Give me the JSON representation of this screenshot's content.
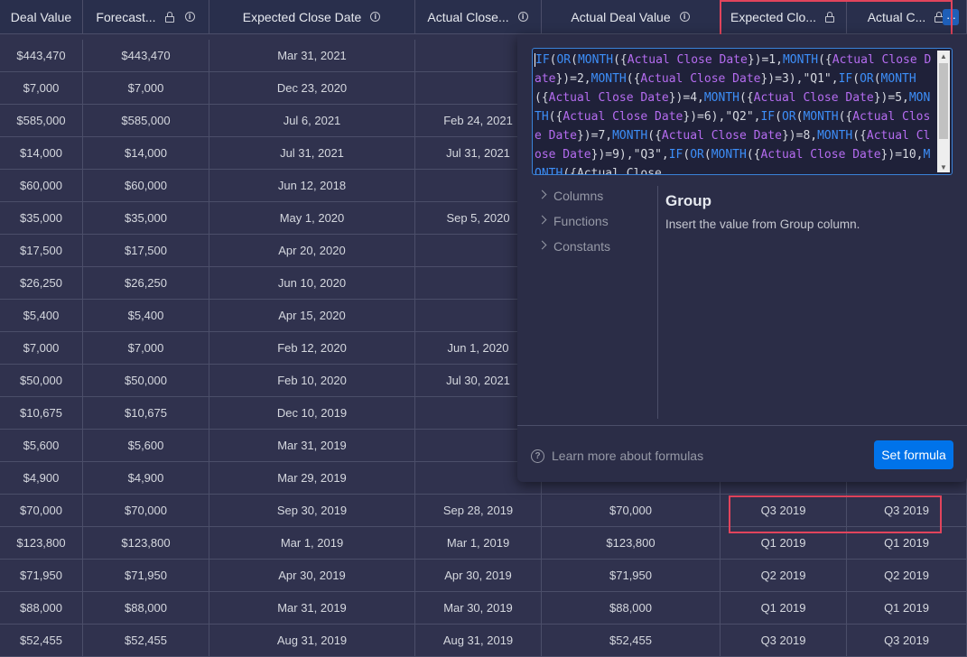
{
  "columns": [
    {
      "label": "Deal Value",
      "lock": false,
      "info": false
    },
    {
      "label": "Forecast...",
      "lock": true,
      "info": true
    },
    {
      "label": "Expected Close Date",
      "lock": false,
      "info": true
    },
    {
      "label": "Actual Close...",
      "lock": false,
      "info": true
    },
    {
      "label": "Actual Deal Value",
      "lock": false,
      "info": true
    },
    {
      "label": "Expected Clo...",
      "lock": true,
      "info": false
    },
    {
      "label": "Actual C...",
      "lock": true,
      "info": false
    }
  ],
  "rows": [
    [
      "$443,470",
      "$443,470",
      "Mar 31, 2021",
      "",
      "",
      "",
      ""
    ],
    [
      "$7,000",
      "$7,000",
      "Dec 23, 2020",
      "",
      "",
      "",
      ""
    ],
    [
      "$585,000",
      "$585,000",
      "Jul 6, 2021",
      "Feb 24, 2021",
      "",
      "",
      ""
    ],
    [
      "$14,000",
      "$14,000",
      "Jul 31, 2021",
      "Jul 31, 2021",
      "",
      "",
      ""
    ],
    [
      "$60,000",
      "$60,000",
      "Jun 12, 2018",
      "",
      "",
      "",
      ""
    ],
    [
      "$35,000",
      "$35,000",
      "May 1, 2020",
      "Sep 5, 2020",
      "",
      "",
      ""
    ],
    [
      "$17,500",
      "$17,500",
      "Apr 20, 2020",
      "",
      "",
      "",
      ""
    ],
    [
      "$26,250",
      "$26,250",
      "Jun 10, 2020",
      "",
      "",
      "",
      ""
    ],
    [
      "$5,400",
      "$5,400",
      "Apr 15, 2020",
      "",
      "",
      "",
      ""
    ],
    [
      "$7,000",
      "$7,000",
      "Feb 12, 2020",
      "Jun 1, 2020",
      "",
      "",
      ""
    ],
    [
      "$50,000",
      "$50,000",
      "Feb 10, 2020",
      "Jul 30, 2021",
      "",
      "",
      ""
    ],
    [
      "$10,675",
      "$10,675",
      "Dec 10, 2019",
      "",
      "",
      "",
      ""
    ],
    [
      "$5,600",
      "$5,600",
      "Mar 31, 2019",
      "",
      "",
      "",
      ""
    ],
    [
      "$4,900",
      "$4,900",
      "Mar 29, 2019",
      "",
      "",
      "",
      ""
    ],
    [
      "$70,000",
      "$70,000",
      "Sep 30, 2019",
      "Sep 28, 2019",
      "$70,000",
      "Q3 2019",
      "Q3 2019"
    ],
    [
      "$123,800",
      "$123,800",
      "Mar 1, 2019",
      "Mar 1, 2019",
      "$123,800",
      "Q1 2019",
      "Q1 2019"
    ],
    [
      "$71,950",
      "$71,950",
      "Apr 30, 2019",
      "Apr 30, 2019",
      "$71,950",
      "Q2 2019",
      "Q2 2019"
    ],
    [
      "$88,000",
      "$88,000",
      "Mar 31, 2019",
      "Mar 30, 2019",
      "$88,000",
      "Q1 2019",
      "Q1 2019"
    ],
    [
      "$52,455",
      "$52,455",
      "Aug 31, 2019",
      "Aug 31, 2019",
      "$52,455",
      "Q3 2019",
      "Q3 2019"
    ]
  ],
  "formula_popup": {
    "formula_text": "IF(OR(MONTH({Actual Close Date})=1,MONTH({Actual Close Date})=2,MONTH({Actual Close Date})=3),\"Q1\",IF(OR(MONTH({Actual Close Date})=4,MONTH({Actual Close Date})=5,MONTH({Actual Close Date})=6),\"Q2\",IF(OR(MONTH({Actual Close Date})=7,MONTH({Actual Close Date})=8,MONTH({Actual Close Date})=9),\"Q3\",IF(OR(MONTH({Actual Close Date})=10,MONTH({Actual Close",
    "nav": [
      "Columns",
      "Functions",
      "Constants"
    ],
    "detail_title": "Group",
    "detail_desc": "Insert the value from Group column.",
    "help_text": "Learn more about formulas",
    "set_button": "Set formula"
  },
  "more_menu_glyph": "···",
  "colors": {
    "background": "#30324e",
    "header": "#292f4c",
    "accent": "#0073ea",
    "highlight": "#e2445c",
    "keyword": "#3d8ef8",
    "column_ref": "#b56cf0"
  }
}
